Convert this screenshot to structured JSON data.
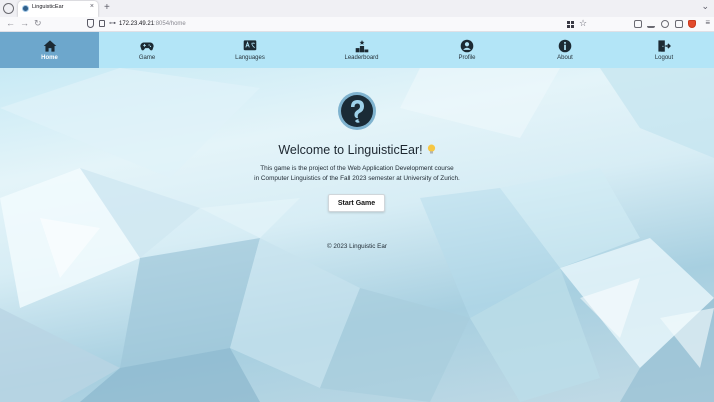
{
  "browser": {
    "tab_title": "LinguisticEar",
    "tab_close": "×",
    "new_tab": "+",
    "url_host": "172.23.49.21",
    "url_path": ":8054/home"
  },
  "nav": {
    "items": [
      {
        "label": "Home",
        "icon": "home-icon",
        "active": true
      },
      {
        "label": "Game",
        "icon": "gamepad-icon"
      },
      {
        "label": "Languages",
        "icon": "language-icon"
      },
      {
        "label": "Leaderboard",
        "icon": "podium-icon"
      },
      {
        "label": "Profile",
        "icon": "user-icon"
      },
      {
        "label": "About",
        "icon": "info-icon"
      },
      {
        "label": "Logout",
        "icon": "logout-icon"
      }
    ]
  },
  "main": {
    "title": "Welcome to LinguisticEar!",
    "intro_line1": "This game is the project of the Web Application Development course",
    "intro_line2": "in Computer Linguistics of the Fall 2023 semester at University of Zurich.",
    "start_button": "Start Game",
    "footer": "© 2023 Linguistic Ear"
  },
  "colors": {
    "nav_bg": "#b3e5f7",
    "nav_active": "#6da7cc",
    "text": "#1d2730"
  }
}
